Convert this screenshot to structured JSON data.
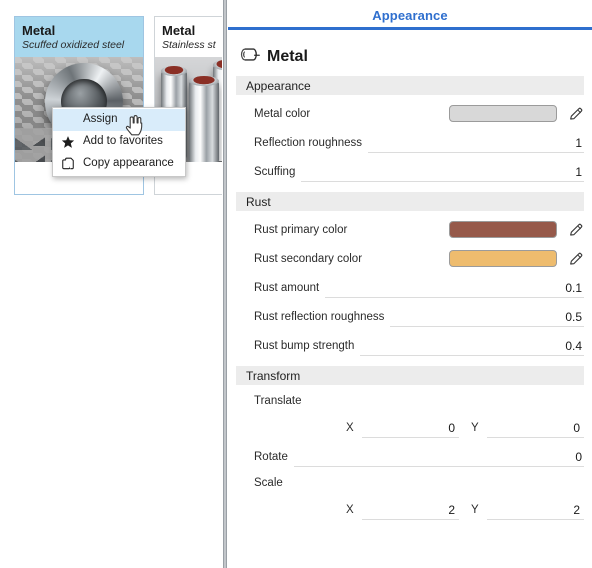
{
  "left_panel": {
    "cards": [
      {
        "title": "Metal",
        "subtitle": "Scuffed oxidized steel",
        "selected": true,
        "thumbnail_name": "metal-torus-checkerboard-thumbnail"
      },
      {
        "title": "Metal",
        "subtitle": "Stainless st",
        "selected": false,
        "thumbnail_name": "metal-cylinders-thumbnail"
      }
    ],
    "context_menu": {
      "items": [
        {
          "label": "Assign",
          "icon": "none",
          "highlighted": true
        },
        {
          "label": "Add to favorites",
          "icon": "star-icon",
          "highlighted": false
        },
        {
          "label": "Copy appearance",
          "icon": "copy-icon",
          "highlighted": false
        }
      ]
    },
    "cursor": "hand-pointer-cursor"
  },
  "right_panel": {
    "tab_label": "Appearance",
    "tab_accent_color": "#2f6fce",
    "title": "Metal",
    "title_icon": "cylinder-material-icon",
    "sections": [
      {
        "header": "Appearance",
        "rows": [
          {
            "type": "color",
            "label": "Metal color",
            "color": "#d8d8d8",
            "edit_icon": "pencil-icon"
          },
          {
            "type": "value",
            "label": "Reflection roughness",
            "value": "1"
          },
          {
            "type": "value",
            "label": "Scuffing",
            "value": "1"
          }
        ]
      },
      {
        "header": "Rust",
        "rows": [
          {
            "type": "color",
            "label": "Rust primary color",
            "color": "#96594a",
            "edit_icon": "pencil-icon"
          },
          {
            "type": "color",
            "label": "Rust secondary color",
            "color": "#eebc6e",
            "edit_icon": "pencil-icon"
          },
          {
            "type": "value",
            "label": "Rust amount",
            "value": "0.1"
          },
          {
            "type": "value",
            "label": "Rust reflection roughness",
            "value": "0.5"
          },
          {
            "type": "value",
            "label": "Rust bump strength",
            "value": "0.4"
          }
        ]
      },
      {
        "header": "Transform",
        "translate": {
          "label": "Translate",
          "x_axis": "X",
          "x_value": "0",
          "y_axis": "Y",
          "y_value": "0"
        },
        "rotate": {
          "label": "Rotate",
          "value": "0"
        },
        "scale": {
          "label": "Scale",
          "x_axis": "X",
          "x_value": "2",
          "y_axis": "Y",
          "y_value": "2"
        }
      }
    ]
  }
}
